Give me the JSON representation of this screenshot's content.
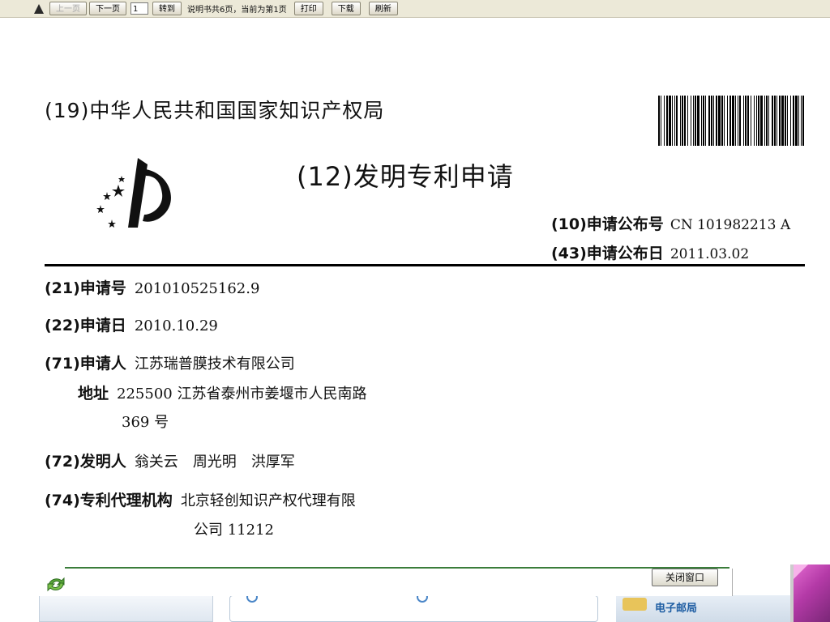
{
  "toolbar": {
    "icon": "printer-icon",
    "prev_page": "上一页",
    "next_page": "下一页",
    "page_input": "1",
    "goto": "转到",
    "page_info": "说明书共6页，当前为第1页",
    "print": "打印",
    "download": "下载",
    "refresh": "刷新"
  },
  "document": {
    "office": "(19)中华人民共和国国家知识产权局",
    "pub_type": "(12)发明专利申请",
    "pub_number_label": "(10)申请公布号",
    "pub_number": "CN 101982213 A",
    "pub_date_label": "(43)申请公布日",
    "pub_date": "2011.03.02",
    "app_number_label": "(21)申请号",
    "app_number": "201010525162.9",
    "filing_date_label": "(22)申请日",
    "filing_date": "2010.10.29",
    "applicant_label": "(71)申请人",
    "applicant": "江苏瑞普膜技术有限公司",
    "address_label": "地址",
    "address_line1": "225500 江苏省泰州市姜堰市人民南路",
    "address_line2": "369 号",
    "inventors_label": "(72)发明人",
    "inventors": [
      "翁关云",
      "周光明",
      "洪厚军"
    ],
    "agency_label": "(74)专利代理机构",
    "agency_line1": "北京轻创知识产权代理有限",
    "agency_line2": "公司 11212"
  },
  "popup": {
    "close_button": "关闭窗口"
  },
  "background": {
    "mail_label": "电子邮局"
  },
  "colors": {
    "toolbar_bg": "#ece9d8",
    "accent_green": "#3a7d3a",
    "corner_magenta": "#b43aa7"
  }
}
